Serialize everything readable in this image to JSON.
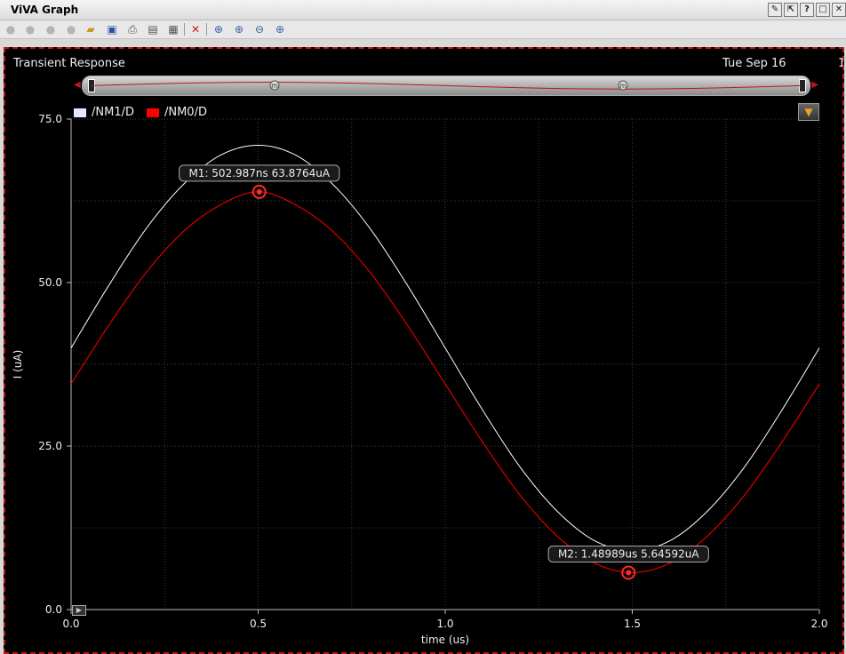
{
  "window": {
    "title": "ViVA Graph"
  },
  "graph": {
    "title": "Transient Response",
    "date": "Tue Sep 16",
    "date_extra": "1",
    "legend": [
      {
        "name": "/NM1/D",
        "color": "#dfe9ff"
      },
      {
        "name": "/NM0/D",
        "color": "#ff0000"
      }
    ],
    "overview_markers": [
      "m",
      "m"
    ]
  },
  "markers": [
    {
      "label": "M1: 502.987ns 63.8764uA",
      "x": 0.502987,
      "y": 63.8764
    },
    {
      "label": "M2: 1.48989us 5.64592uA",
      "x": 1.48989,
      "y": 5.64592
    }
  ],
  "chart_data": {
    "type": "line",
    "xlabel": "time (us)",
    "ylabel": "I (uA)",
    "xlim": [
      0.0,
      2.0
    ],
    "ylim": [
      0.0,
      75.0
    ],
    "x_ticks": [
      "0.0",
      "0.5",
      "1.0",
      "1.5",
      "2.0"
    ],
    "y_ticks": [
      "0.0",
      "25.0",
      "50.0",
      "75.0"
    ],
    "grid": true,
    "series": [
      {
        "name": "/NM1/D",
        "color": "#ffffff",
        "x": [
          0.0,
          0.1,
          0.2,
          0.3,
          0.4,
          0.5,
          0.6,
          0.7,
          0.8,
          0.9,
          1.0,
          1.1,
          1.2,
          1.3,
          1.4,
          1.5,
          1.6,
          1.7,
          1.8,
          1.9,
          2.0
        ],
        "y": [
          40.0,
          49.5,
          58.2,
          65.0,
          69.5,
          71.0,
          69.5,
          65.0,
          58.2,
          49.5,
          40.0,
          30.5,
          21.8,
          15.0,
          10.5,
          9.0,
          10.5,
          15.0,
          21.8,
          30.5,
          40.0
        ]
      },
      {
        "name": "/NM0/D",
        "color": "#ff0000",
        "x": [
          0.0,
          0.1,
          0.2,
          0.3,
          0.4,
          0.5,
          0.6,
          0.7,
          0.8,
          0.9,
          1.0,
          1.1,
          1.2,
          1.3,
          1.4,
          1.5,
          1.6,
          1.7,
          1.8,
          1.9,
          2.0
        ],
        "y": [
          34.5,
          43.4,
          51.5,
          57.8,
          61.9,
          63.9,
          61.9,
          57.8,
          51.5,
          43.4,
          34.5,
          25.6,
          17.5,
          11.2,
          7.1,
          5.65,
          7.1,
          11.2,
          17.5,
          25.6,
          34.5
        ]
      }
    ]
  }
}
